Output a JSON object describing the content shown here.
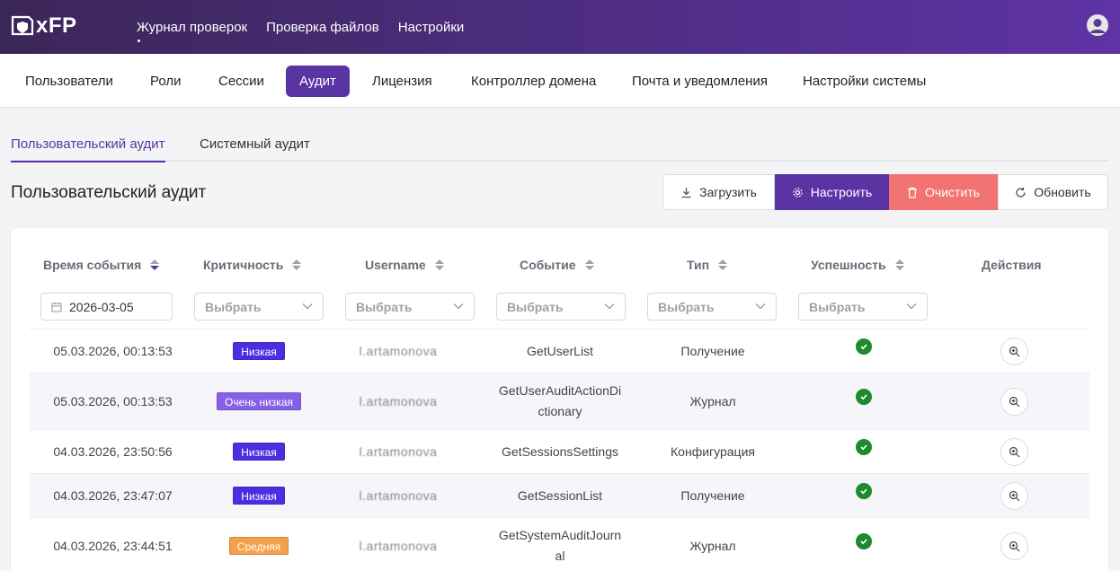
{
  "app": {
    "logo_text": "xFP"
  },
  "topnav": [
    "Журнал проверок",
    "Проверка файлов",
    "Настройки"
  ],
  "subnav": [
    "Пользователи",
    "Роли",
    "Сессии",
    "Аудит",
    "Лицензия",
    "Контроллер домена",
    "Почта и уведомления",
    "Настройки системы"
  ],
  "tabs": [
    "Пользовательский аудит",
    "Системный аудит"
  ],
  "page_title": "Пользовательский аудит",
  "actions": {
    "download": "Загрузить",
    "settings": "Настроить",
    "clear": "Очистить",
    "refresh": "Обновить"
  },
  "columns": [
    "Время события",
    "Критичность",
    "Username",
    "Событие",
    "Тип",
    "Успешность",
    "Действия"
  ],
  "filters": {
    "date": "2026-03-05",
    "select_placeholder": "Выбрать"
  },
  "rows": [
    {
      "time": "05.03.2026, 00:13:53",
      "severity": "Низкая",
      "username": "l.artamonova",
      "event_1": "GetUserList",
      "event_2": "",
      "type": "Получение"
    },
    {
      "time": "05.03.2026, 00:13:53",
      "severity": "Очень низкая",
      "username": "l.artamonova",
      "event_1": "GetUserAuditActionDi",
      "event_2": "ctionary",
      "type": "Журнал"
    },
    {
      "time": "04.03.2026, 23:50:56",
      "severity": "Низкая",
      "username": "l.artamonova",
      "event_1": "GetSessionsSettings",
      "event_2": "",
      "type": "Конфигурация"
    },
    {
      "time": "04.03.2026, 23:47:07",
      "severity": "Низкая",
      "username": "l.artamonova",
      "event_1": "GetSessionList",
      "event_2": "",
      "type": "Получение"
    },
    {
      "time": "04.03.2026, 23:44:51",
      "severity": "Средняя",
      "username": "l.artamonova",
      "event_1": "GetSystemAuditJourn",
      "event_2": "al",
      "type": "Журнал"
    }
  ]
}
